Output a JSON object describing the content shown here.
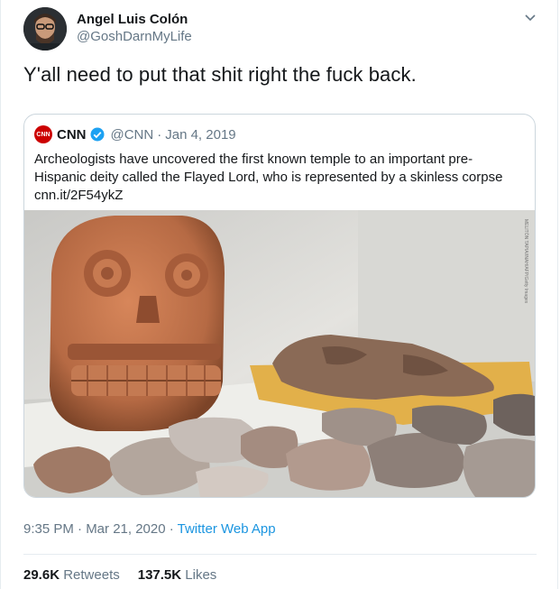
{
  "author": {
    "name": "Angel Luis Colón",
    "handle": "@GoshDarnMyLife"
  },
  "tweet": {
    "text": "Y'all need to put that shit right the fuck back."
  },
  "quoted": {
    "logo_text": "CNN",
    "name": "CNN",
    "handle": "@CNN",
    "separator": "·",
    "date": "Jan 4, 2019",
    "body_line1": "Archeologists have uncovered the first known temple to an important pre-",
    "body_line2": "Hispanic deity called the Flayed Lord, who is represented by a skinless corpse",
    "link": "cnn.it/2F54ykZ",
    "photo_credit": "MELITÓN TAPIA/INAH/AFP/Getty Images"
  },
  "meta": {
    "time_date": "9:35 PM · Mar 21, 2020 · ",
    "app": "Twitter Web App"
  },
  "stats": {
    "retweets_count": "29.6K",
    "retweets_label": "Retweets",
    "likes_count": "137.5K",
    "likes_label": "Likes"
  },
  "colors": {
    "link_blue": "#1b95e0",
    "verified_blue": "#1da1f2",
    "cnn_red": "#cc0000",
    "secondary_text": "#657786"
  }
}
